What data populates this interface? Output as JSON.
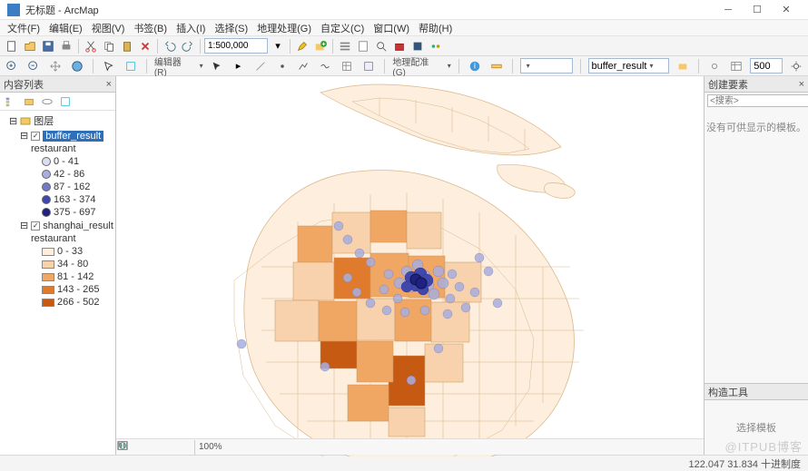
{
  "app": {
    "title": "无标题 - ArcMap"
  },
  "menu": [
    "文件(F)",
    "编辑(E)",
    "视图(V)",
    "书签(B)",
    "插入(I)",
    "选择(S)",
    "地理处理(G)",
    "自定义(C)",
    "窗口(W)",
    "帮助(H)"
  ],
  "toolbar": {
    "scale": "1:500,000"
  },
  "toolbar2": {
    "editor_label": "编辑器(R)",
    "geo_label": "地理配准(G)",
    "layer_combo": "buffer_result",
    "num": "500"
  },
  "mapbar": {
    "zoom": "100%"
  },
  "toc": {
    "title": "内容列表",
    "root": "图层",
    "layers": [
      {
        "name": "buffer_result",
        "field": "restaurant",
        "classes": [
          {
            "color": "#dcdff0",
            "label": "0 - 41"
          },
          {
            "color": "#a9aedd",
            "label": "42 - 86"
          },
          {
            "color": "#7279c8",
            "label": "87 - 162"
          },
          {
            "color": "#4047ad",
            "label": "163 - 374"
          },
          {
            "color": "#1f2280",
            "label": "375 - 697"
          }
        ]
      },
      {
        "name": "shanghai_result",
        "field": "restaurant",
        "classes": [
          {
            "color": "#fdeedd",
            "label": "0 - 33"
          },
          {
            "color": "#f8d2ac",
            "label": "34 - 80"
          },
          {
            "color": "#f0a764",
            "label": "81 - 142"
          },
          {
            "color": "#e07b2e",
            "label": "143 - 265"
          },
          {
            "color": "#c75a13",
            "label": "266 - 502"
          }
        ]
      }
    ]
  },
  "right": {
    "title": "创建要素",
    "search_ph": "<搜索>",
    "empty": "没有可供显示的模板。",
    "tool_title": "构造工具",
    "tool_empty": "选择模板"
  },
  "status": {
    "coords": "122.047  31.834 十进制度"
  },
  "watermark": "@ITPUB博客"
}
